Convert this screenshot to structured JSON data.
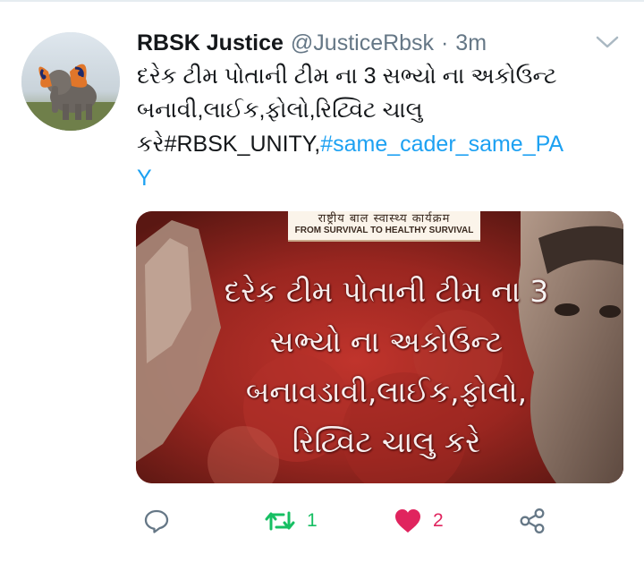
{
  "tweet": {
    "author": {
      "name": "RBSK Justice",
      "handle": "@JusticeRbsk",
      "separator": "·",
      "time": "3m"
    },
    "text": {
      "line1": "દરેક ટીમ પોતાની ટીમ ના 3 સભ્યો ના અકોઉન્ટ",
      "line2": "બનાવી,લાઈક,ફોલો,રિટ્વિટ ચાલુ",
      "line3_prefix": "કરે",
      "hashtag1": "#RBSK_UNITY,",
      "hashtag2": "#same_cader_same_PA",
      "hashtag2_wrap": "Y"
    },
    "media": {
      "banner_hindi": "राष्ट्रीय बाल स्वास्थ्य कार्यक्रम",
      "banner_english": "FROM SURVIVAL TO HEALTHY SURVIVAL",
      "overlay_line1": "દરેક ટીમ પોતાની ટીમ ના 3",
      "overlay_line2": "સભ્યો ના અકોઉન્ટ",
      "overlay_line3": "બનાવડાવી,લાઈક,ફોલો,",
      "overlay_line4": "રિટ્વિટ ચાલુ કરે"
    },
    "actions": {
      "reply_icon": "reply-icon",
      "retweet_icon": "retweet-icon",
      "retweet_count": "1",
      "like_icon": "heart-icon",
      "like_count": "2",
      "share_icon": "share-icon"
    }
  },
  "colors": {
    "link": "#1da1f2",
    "muted": "#657786",
    "retweet": "#17bf63",
    "like": "#e0245e",
    "text": "#14171a"
  }
}
